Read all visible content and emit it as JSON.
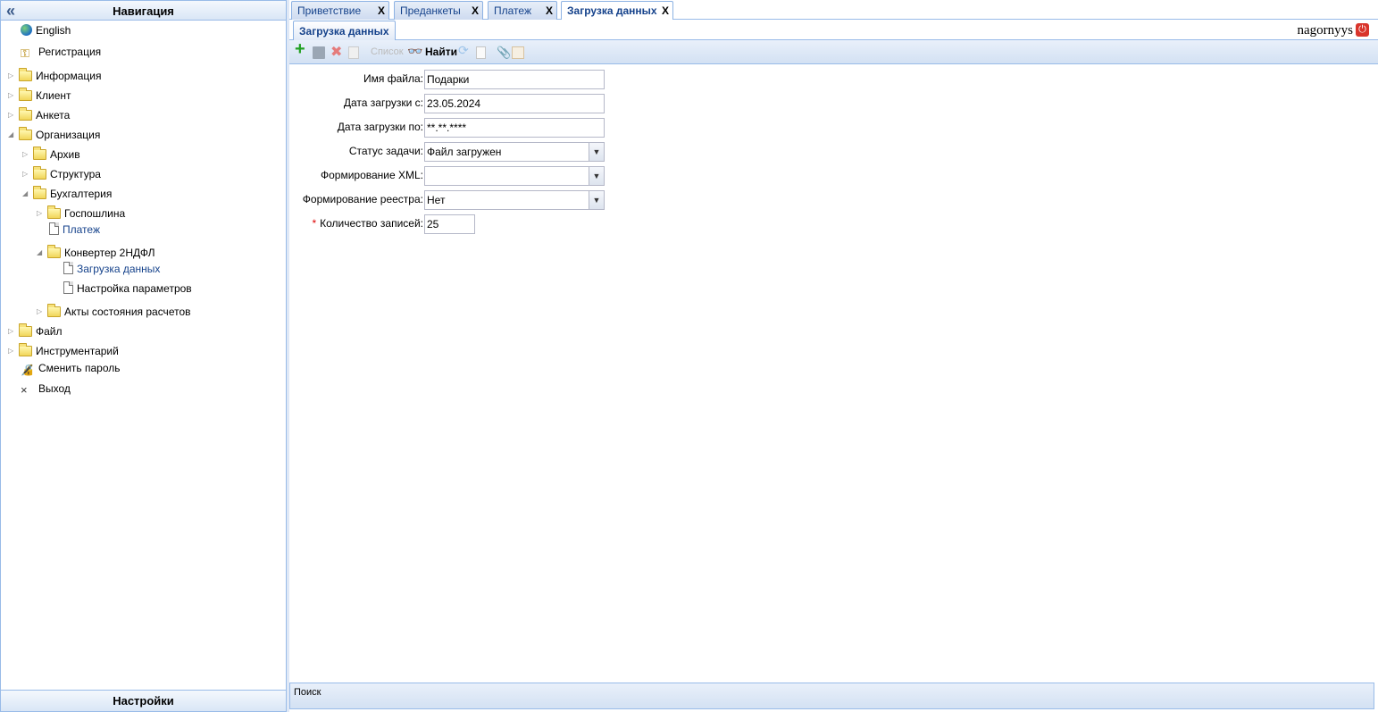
{
  "nav": {
    "title": "Навигация",
    "footer": "Настройки",
    "items": [
      {
        "label": "English"
      },
      {
        "label": "Регистрация"
      },
      {
        "label": "Информация"
      },
      {
        "label": "Клиент"
      },
      {
        "label": "Анкета"
      },
      {
        "label": "Организация"
      },
      {
        "label": "Архив"
      },
      {
        "label": "Структура"
      },
      {
        "label": "Бухгалтерия"
      },
      {
        "label": "Госпошлина"
      },
      {
        "label": "Платеж"
      },
      {
        "label": "Конвертер 2НДФЛ"
      },
      {
        "label": "Загрузка данных"
      },
      {
        "label": "Настройка параметров"
      },
      {
        "label": "Акты состояния расчетов"
      },
      {
        "label": "Файл"
      },
      {
        "label": "Инструментарий"
      },
      {
        "label": "Сменить пароль"
      },
      {
        "label": "Выход"
      }
    ]
  },
  "tabs": [
    {
      "label": "Приветствие",
      "close": "X"
    },
    {
      "label": "Преданкеты",
      "close": "X"
    },
    {
      "label": "Платеж",
      "close": "X"
    },
    {
      "label": "Загрузка данных",
      "close": "X"
    }
  ],
  "subtab": "Загрузка данных",
  "user": {
    "name": "nagornyys"
  },
  "toolbar": {
    "list_label": "Список",
    "find_label": "Найти"
  },
  "form": {
    "file_name": {
      "label": "Имя файла:",
      "value": "Подарки"
    },
    "date_from": {
      "label": "Дата загрузки с:",
      "value": "23.05.2024"
    },
    "date_to": {
      "label": "Дата загрузки по:",
      "value": "**.**.****"
    },
    "task_status": {
      "label": "Статус задачи:",
      "value": "Файл загружен"
    },
    "xml_formation": {
      "label": "Формирование XML:",
      "value": ""
    },
    "registry_formation": {
      "label": "Формирование реестра:",
      "value": "Нет"
    },
    "record_count": {
      "label": "Количество записей:",
      "value": "25",
      "required_mark": "*"
    }
  },
  "statusbar": {
    "label": "Поиск"
  },
  "colors": {
    "accent": "#15428b",
    "border": "#99bbe8",
    "required": "#dd0000"
  }
}
